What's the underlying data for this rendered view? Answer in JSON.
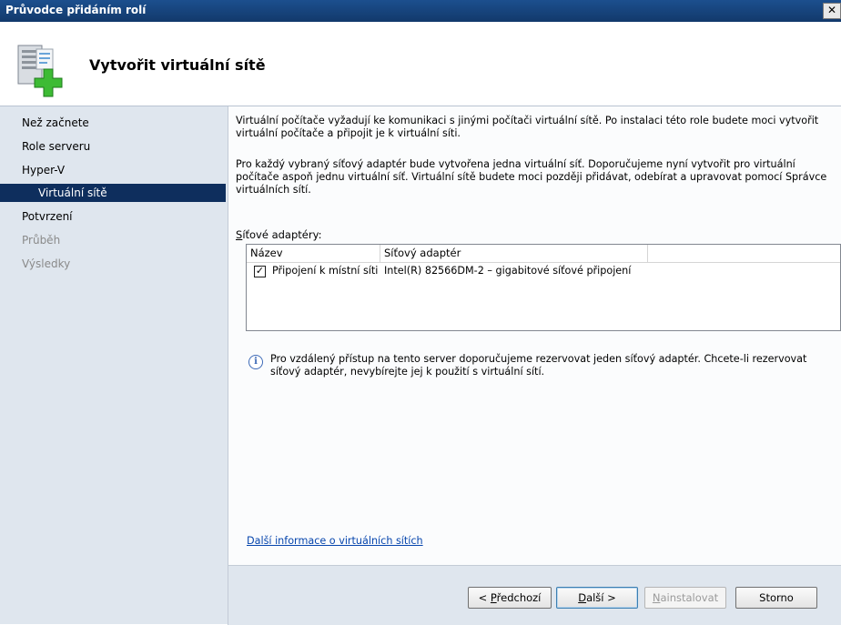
{
  "window": {
    "title": "Průvodce přidáním rolí",
    "close_label": "✕"
  },
  "header": {
    "icon": "server-add-icon",
    "title": "Vytvořit virtuální sítě"
  },
  "nav": {
    "items": [
      {
        "label": "Než začnete",
        "state": "normal"
      },
      {
        "label": "Role serveru",
        "state": "normal"
      },
      {
        "label": "Hyper-V",
        "state": "normal"
      },
      {
        "label": "Virtuální sítě",
        "state": "selected"
      },
      {
        "label": "Potvrzení",
        "state": "normal"
      },
      {
        "label": "Průběh",
        "state": "disabled"
      },
      {
        "label": "Výsledky",
        "state": "disabled"
      }
    ]
  },
  "content": {
    "para1": "Virtuální počítače vyžadují ke komunikaci s jinými počítači virtuální sítě. Po instalaci této role budete moci vytvořit virtuální počítače a připojit je k virtuální síti.",
    "para2": "Pro každý vybraný síťový adaptér bude vytvořena jedna virtuální síť. Doporučujeme nyní vytvořit pro virtuální počítače aspoň jednu virtuální síť. Virtuální sítě budete moci později přidávat, odebírat a upravovat pomocí Správce virtuálních sítí.",
    "adapters_label": "Síťové adaptéry:",
    "adapters_label_access": "S",
    "adapters_label_rest": "íťové adaptéry:",
    "columns": [
      "Název",
      "Síťový adaptér",
      ""
    ],
    "rows": [
      {
        "checked": true,
        "name": "Připojení k místní síti",
        "adapter": "Intel(R) 82566DM-2 – gigabitové síťové připojení"
      }
    ],
    "info_icon": "info-icon",
    "info_text": "Pro vzdálený přístup na tento server doporučujeme rezervovat jeden síťový adaptér. Chcete-li rezervovat síťový adaptér, nevybírejte jej k použití s virtuální sítí.",
    "link": "Další informace o virtuálních sítích"
  },
  "footer": {
    "back_pre": "< ",
    "back_key": "P",
    "back_rest": "ředchozí",
    "next_key": "D",
    "next_rest": "alší >",
    "install_key": "N",
    "install_rest": "ainstalovat",
    "cancel": "Storno"
  }
}
